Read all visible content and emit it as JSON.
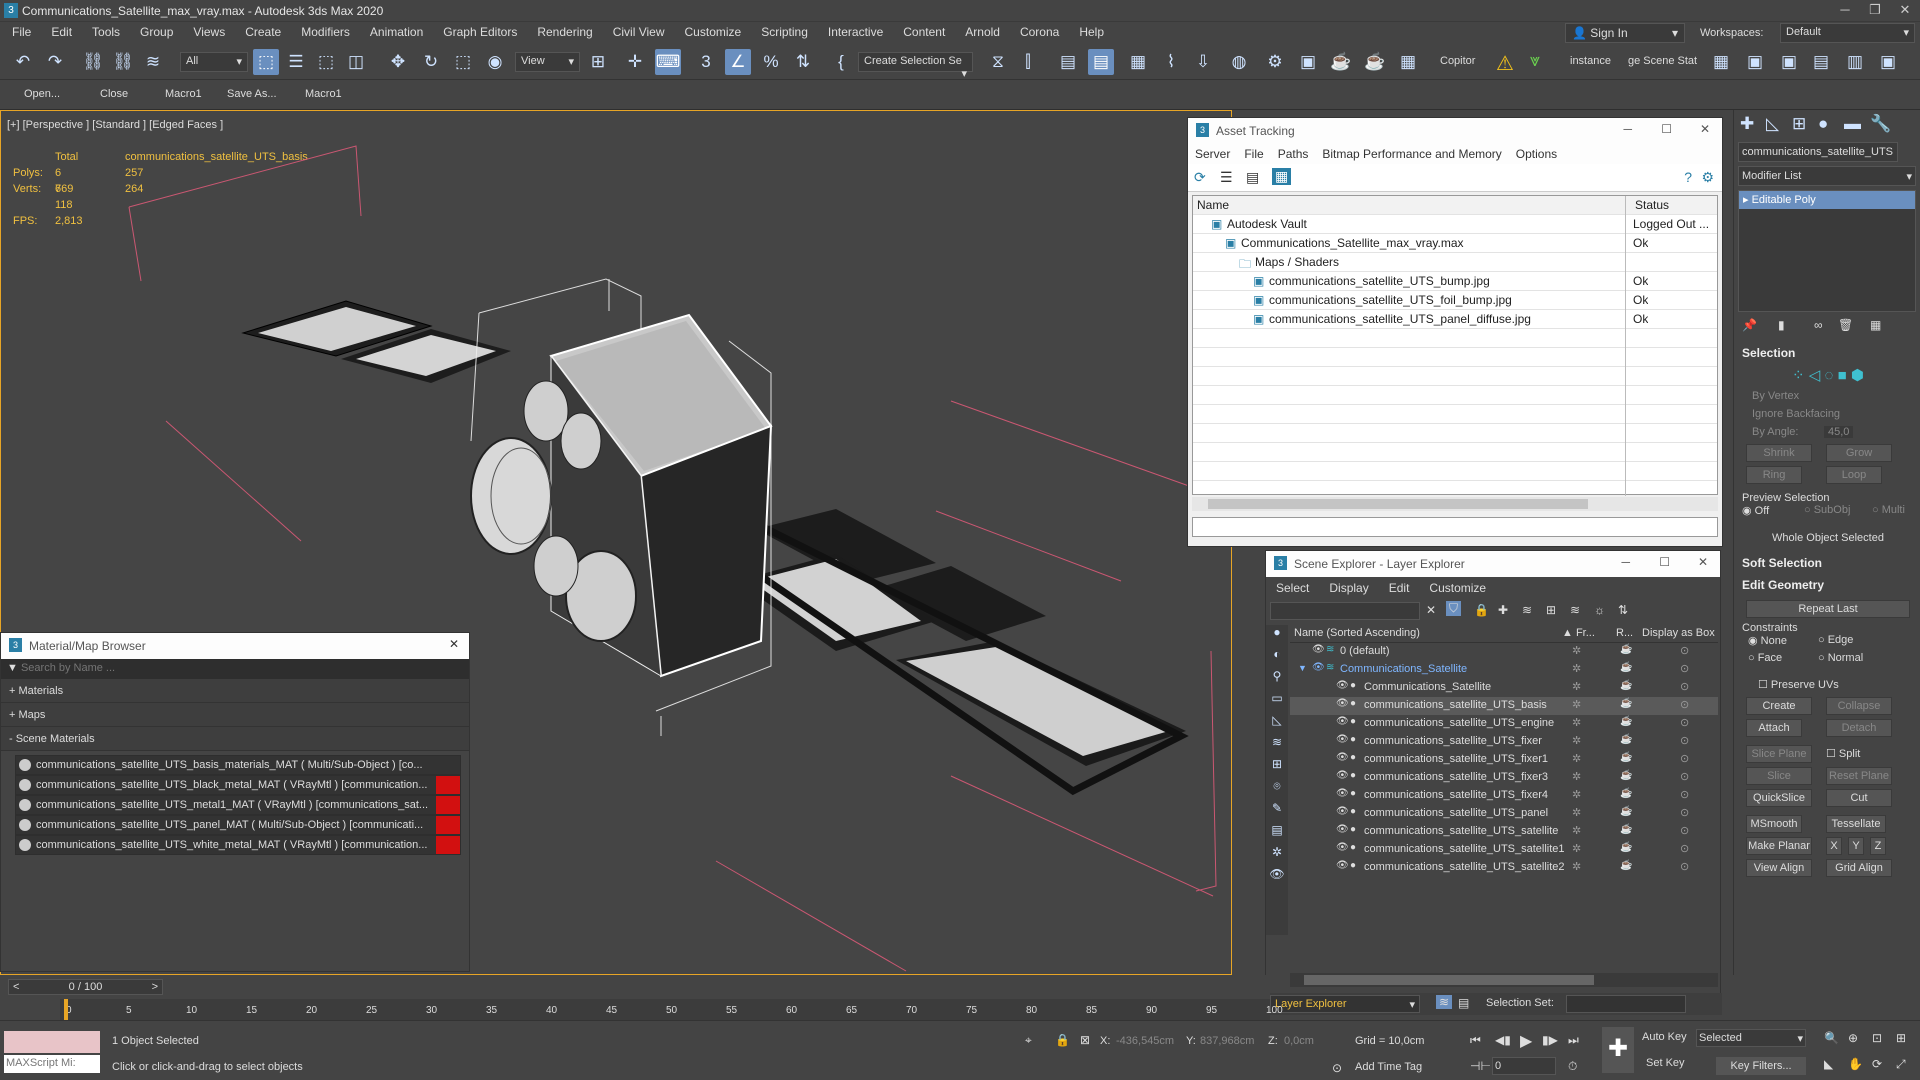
{
  "window": {
    "title": "Communications_Satellite_max_vray.max - Autodesk 3ds Max 2020"
  },
  "menu": [
    "File",
    "Edit",
    "Tools",
    "Group",
    "Views",
    "Create",
    "Modifiers",
    "Animation",
    "Graph Editors",
    "Rendering",
    "Civil View",
    "Customize",
    "Scripting",
    "Interactive",
    "Content",
    "Arnold",
    "Corona",
    "Help"
  ],
  "account": {
    "sign_in": "Sign In",
    "workspaces_label": "Workspaces:",
    "workspace": "Default"
  },
  "toolbar": {
    "filter": "All",
    "ref_coord": "View",
    "selection_set": "Create Selection Se",
    "copitor": "Copitor",
    "instance": "instance",
    "scene_stat": "ge Scene Stat"
  },
  "quick": [
    "Open...",
    "Close",
    "Macro1",
    "Save As...",
    "Macro1"
  ],
  "viewport": {
    "label": "[+] [Perspective ] [Standard ] [Edged Faces ]",
    "stats": {
      "total_label": "Total",
      "object_name": "communications_satellite_UTS_basis",
      "polys_label": "Polys:",
      "polys_total": "6 769",
      "polys_sel": "257",
      "verts_label": "Verts:",
      "verts_total": "6 118",
      "verts_sel": "264",
      "fps_label": "FPS:",
      "fps": "2,813"
    }
  },
  "asset_tracking": {
    "title": "Asset Tracking",
    "menu": [
      "Server",
      "File",
      "Paths",
      "Bitmap Performance and Memory",
      "Options"
    ],
    "col_name": "Name",
    "col_status": "Status",
    "rows": [
      {
        "name": "Autodesk Vault",
        "status": "Logged Out ...",
        "indent": 1
      },
      {
        "name": "Communications_Satellite_max_vray.max",
        "status": "Ok",
        "indent": 2
      },
      {
        "name": "Maps / Shaders",
        "status": "",
        "indent": 3
      },
      {
        "name": "communications_satellite_UTS_bump.jpg",
        "status": "Ok",
        "indent": 4
      },
      {
        "name": "communications_satellite_UTS_foil_bump.jpg",
        "status": "Ok",
        "indent": 4
      },
      {
        "name": "communications_satellite_UTS_panel_diffuse.jpg",
        "status": "Ok",
        "indent": 4
      }
    ]
  },
  "material_browser": {
    "title": "Material/Map Browser",
    "search_placeholder": "Search by Name ...",
    "groups": [
      "+ Materials",
      "+ Maps",
      "- Scene Materials"
    ],
    "items": [
      "communications_satellite_UTS_basis_materials_MAT ( Multi/Sub-Object ) [co...",
      "communications_satellite_UTS_black_metal_MAT ( VRayMtl ) [communication...",
      "communications_satellite_UTS_metal1_MAT ( VRayMtl ) [communications_sat...",
      "communications_satellite_UTS_panel_MAT ( Multi/Sub-Object ) [communicati...",
      "communications_satellite_UTS_white_metal_MAT ( VRayMtl ) [communication..."
    ]
  },
  "scene_explorer": {
    "title": "Scene Explorer - Layer Explorer",
    "menu": [
      "Select",
      "Display",
      "Edit",
      "Customize"
    ],
    "col_name": "Name (Sorted Ascending)",
    "col_fr": "▲ Fr...",
    "col_r": "R...",
    "col_box": "Display as Box",
    "rows": [
      {
        "name": "0 (default)",
        "level": 0
      },
      {
        "name": "Communications_Satellite",
        "level": 0
      },
      {
        "name": "Communications_Satellite",
        "level": 1
      },
      {
        "name": "communications_satellite_UTS_basis",
        "level": 1
      },
      {
        "name": "communications_satellite_UTS_engine",
        "level": 1
      },
      {
        "name": "communications_satellite_UTS_fixer",
        "level": 1
      },
      {
        "name": "communications_satellite_UTS_fixer1",
        "level": 1
      },
      {
        "name": "communications_satellite_UTS_fixer3",
        "level": 1
      },
      {
        "name": "communications_satellite_UTS_fixer4",
        "level": 1
      },
      {
        "name": "communications_satellite_UTS_panel",
        "level": 1
      },
      {
        "name": "communications_satellite_UTS_satellite",
        "level": 1
      },
      {
        "name": "communications_satellite_UTS_satellite1",
        "level": 1
      },
      {
        "name": "communications_satellite_UTS_satellite2",
        "level": 1
      }
    ],
    "footer_layer": "Layer Explorer",
    "selection_set_label": "Selection Set:"
  },
  "command_panel": {
    "object_name": "communications_satellite_UTS",
    "modifier_list": "Modifier List",
    "modifier": "Editable Poly",
    "selection": "Selection",
    "by_vertex": "By Vertex",
    "ignore_backfacing": "Ignore Backfacing",
    "by_angle": "By Angle:",
    "by_angle_val": "45,0",
    "shrink": "Shrink",
    "grow": "Grow",
    "ring": "Ring",
    "loop": "Loop",
    "preview_selection": "Preview Selection",
    "off": "Off",
    "subobj": "SubObj",
    "multi": "Multi",
    "whole_object": "Whole Object Selected",
    "soft_selection": "Soft Selection",
    "edit_geometry": "Edit Geometry",
    "repeat_last": "Repeat Last",
    "constraints": "Constraints",
    "none": "None",
    "edge": "Edge",
    "face": "Face",
    "normal": "Normal",
    "preserve_uvs": "Preserve UVs",
    "create": "Create",
    "collapse": "Collapse",
    "attach": "Attach",
    "detach": "Detach",
    "slice_plane": "Slice Plane",
    "split": "Split",
    "slice": "Slice",
    "reset_plane": "Reset Plane",
    "quickslice": "QuickSlice",
    "cut": "Cut",
    "msmooth": "MSmooth",
    "tessellate": "Tessellate",
    "make_planar": "Make Planar",
    "x": "X",
    "y": "Y",
    "z": "Z",
    "view_align": "View Align",
    "grid_align": "Grid Align"
  },
  "timeline": {
    "frame": "0 / 100",
    "ticks": [
      "0",
      "5",
      "10",
      "15",
      "20",
      "25",
      "30",
      "35",
      "40",
      "45",
      "50",
      "55",
      "60",
      "65",
      "70",
      "75",
      "80",
      "85",
      "90",
      "95",
      "100"
    ]
  },
  "status": {
    "maxscript": "MAXScript Mi:",
    "selected": "1 Object Selected",
    "hint": "Click or click-and-drag to select objects",
    "x_label": "X:",
    "x": "-436,545cm",
    "y_label": "Y:",
    "y": "837,968cm",
    "z_label": "Z:",
    "z": "0,0cm",
    "grid": "Grid = 10,0cm",
    "add_time_tag": "Add Time Tag",
    "auto_key": "Auto Key",
    "set_key": "Set Key",
    "selected_dd": "Selected",
    "key_filters": "Key Filters...",
    "frame_val": "0"
  }
}
